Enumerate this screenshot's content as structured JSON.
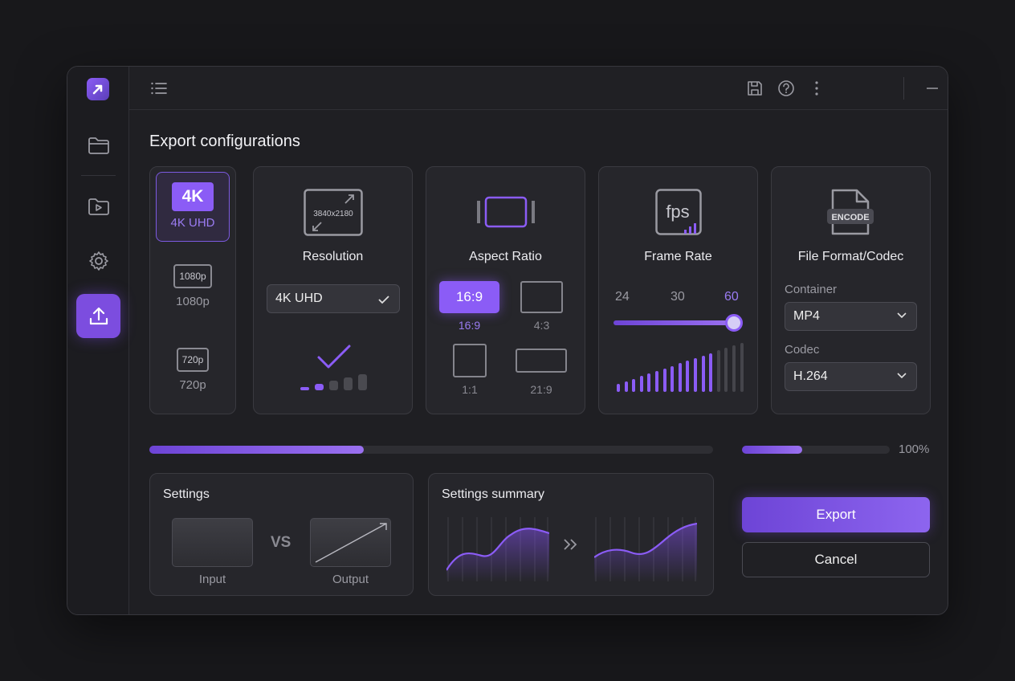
{
  "page": {
    "title": "Export configurations"
  },
  "colors": {
    "accent": "#8b5cf6",
    "accent_dark": "#6d44d6",
    "background": "#18181b",
    "panel": "#26262b"
  },
  "sidebar": {
    "items": [
      {
        "name": "folder",
        "icon": "folder-icon",
        "active": false
      },
      {
        "name": "media",
        "icon": "play-folder-icon",
        "active": false
      },
      {
        "name": "settings",
        "icon": "gear-icon",
        "active": false
      },
      {
        "name": "export",
        "icon": "upload-icon",
        "active": true
      }
    ]
  },
  "topbar": {
    "icons": [
      "menu-icon",
      "save-icon",
      "help-icon",
      "more-icon",
      "minimize-icon",
      "maximize-icon",
      "close-icon"
    ]
  },
  "resolution_presets": [
    {
      "badge": "4K",
      "label": "4K UHD",
      "selected": true
    },
    {
      "badge": "1080p",
      "label": "1080p",
      "selected": false
    },
    {
      "badge": "720p",
      "label": "720p",
      "selected": false
    }
  ],
  "resolution": {
    "title": "Resolution",
    "icon_text": "3840x2180",
    "selected": "4K UHD"
  },
  "aspect_ratio": {
    "title": "Aspect Ratio",
    "options": [
      {
        "label": "16:9",
        "selected": true
      },
      {
        "label": "4:3",
        "selected": false
      },
      {
        "label": "1:1",
        "selected": false
      },
      {
        "label": "21:9",
        "selected": false
      }
    ]
  },
  "frame_rate": {
    "title": "Frame Rate",
    "icon_text": "fps",
    "options": [
      "24",
      "30",
      "60"
    ],
    "selected": "60",
    "slider_value": 1.0
  },
  "format": {
    "title": "File Format/Codec",
    "icon_text": "ENCODE",
    "container_label": "Container",
    "container_value": "MP4",
    "codec_label": "Codec",
    "codec_value": "H.264"
  },
  "progress": {
    "main_fraction": 0.38,
    "secondary_fraction": 0.41,
    "percent_label": "100%"
  },
  "settings_panel": {
    "title": "Settings",
    "input_label": "Input",
    "vs_label": "VS",
    "output_label": "Output"
  },
  "summary_panel": {
    "title": "Settings summary"
  },
  "actions": {
    "export_label": "Export",
    "cancel_label": "Cancel"
  }
}
